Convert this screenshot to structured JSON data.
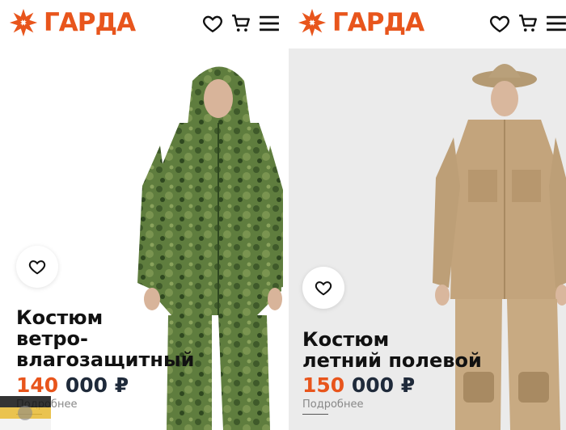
{
  "brand": {
    "name": "ГАРДА",
    "color": "#e8551c"
  },
  "header_icons": [
    "heart-icon",
    "cart-icon",
    "menu-icon"
  ],
  "products": [
    {
      "title_lines": [
        "Костюм",
        "ветро-",
        "влагозащитный"
      ],
      "price_main": "140",
      "price_rest": " 000 ₽",
      "details_link": "Подробнее"
    },
    {
      "title_lines": [
        "Костюм",
        "летний полевой"
      ],
      "price_main": "150",
      "price_rest": " 000 ₽",
      "details_link": "Подробнее"
    }
  ]
}
